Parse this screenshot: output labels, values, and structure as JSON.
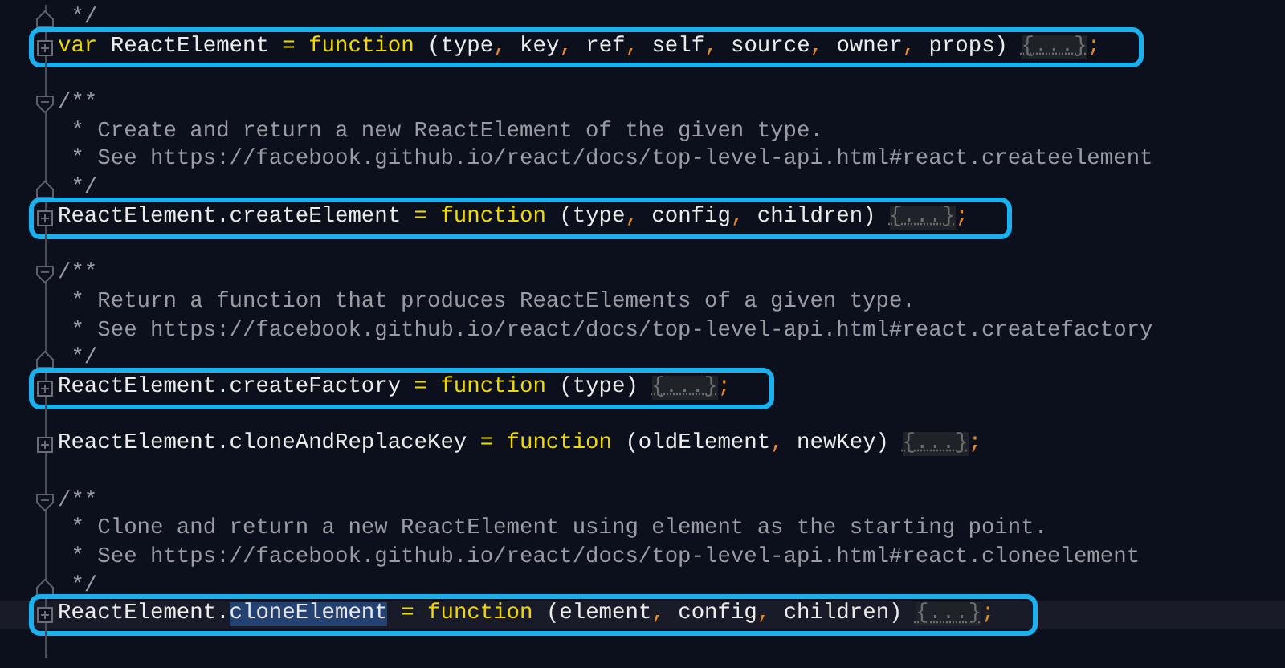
{
  "lines": [
    {
      "kind": "fold_end",
      "boxed": false,
      "current": false,
      "tokens": [
        {
          "kind": "comment",
          "text": " */"
        }
      ]
    },
    {
      "kind": "collapsed",
      "boxed": true,
      "current": false,
      "tokens": [
        {
          "kind": "keyword",
          "text": "var"
        },
        {
          "kind": "plain",
          "text": " ReactElement "
        },
        {
          "kind": "keyword",
          "text": "="
        },
        {
          "kind": "keyword",
          "text": " function"
        },
        {
          "kind": "plain",
          "text": " (type"
        },
        {
          "kind": "punct",
          "text": ","
        },
        {
          "kind": "plain",
          "text": " key"
        },
        {
          "kind": "punct",
          "text": ","
        },
        {
          "kind": "plain",
          "text": " ref"
        },
        {
          "kind": "punct",
          "text": ","
        },
        {
          "kind": "plain",
          "text": " self"
        },
        {
          "kind": "punct",
          "text": ","
        },
        {
          "kind": "plain",
          "text": " source"
        },
        {
          "kind": "punct",
          "text": ","
        },
        {
          "kind": "plain",
          "text": " owner"
        },
        {
          "kind": "punct",
          "text": ","
        },
        {
          "kind": "plain",
          "text": " props) "
        },
        {
          "kind": "folded",
          "text": "{...}"
        },
        {
          "kind": "punct",
          "text": ";"
        }
      ]
    },
    {
      "kind": "blank"
    },
    {
      "kind": "fold_start",
      "boxed": false,
      "current": false,
      "tokens": [
        {
          "kind": "comment",
          "text": "/**"
        }
      ]
    },
    {
      "kind": "code",
      "boxed": false,
      "current": false,
      "tokens": [
        {
          "kind": "comment",
          "text": " * Create and return a new ReactElement of the given type."
        }
      ]
    },
    {
      "kind": "code",
      "boxed": false,
      "current": false,
      "tokens": [
        {
          "kind": "comment",
          "text": " * See https://facebook.github.io/react/docs/top-level-api.html#react.createelement"
        }
      ]
    },
    {
      "kind": "fold_end",
      "boxed": false,
      "current": false,
      "tokens": [
        {
          "kind": "comment",
          "text": " */"
        }
      ]
    },
    {
      "kind": "collapsed",
      "boxed": true,
      "current": false,
      "tokens": [
        {
          "kind": "plain",
          "text": "ReactElement.createElement "
        },
        {
          "kind": "keyword",
          "text": "="
        },
        {
          "kind": "keyword",
          "text": " function"
        },
        {
          "kind": "plain",
          "text": " (type"
        },
        {
          "kind": "punct",
          "text": ","
        },
        {
          "kind": "plain",
          "text": " config"
        },
        {
          "kind": "punct",
          "text": ","
        },
        {
          "kind": "plain",
          "text": " children) "
        },
        {
          "kind": "folded",
          "text": "{...}"
        },
        {
          "kind": "punct",
          "text": ";"
        }
      ]
    },
    {
      "kind": "blank"
    },
    {
      "kind": "fold_start",
      "boxed": false,
      "current": false,
      "tokens": [
        {
          "kind": "comment",
          "text": "/**"
        }
      ]
    },
    {
      "kind": "code",
      "boxed": false,
      "current": false,
      "tokens": [
        {
          "kind": "comment",
          "text": " * Return a function that produces ReactElements of a given type."
        }
      ]
    },
    {
      "kind": "code",
      "boxed": false,
      "current": false,
      "tokens": [
        {
          "kind": "comment",
          "text": " * See https://facebook.github.io/react/docs/top-level-api.html#react.createfactory"
        }
      ]
    },
    {
      "kind": "fold_end",
      "boxed": false,
      "current": false,
      "tokens": [
        {
          "kind": "comment",
          "text": " */"
        }
      ]
    },
    {
      "kind": "collapsed",
      "boxed": true,
      "current": false,
      "tokens": [
        {
          "kind": "plain",
          "text": "ReactElement.createFactory "
        },
        {
          "kind": "keyword",
          "text": "="
        },
        {
          "kind": "keyword",
          "text": " function"
        },
        {
          "kind": "plain",
          "text": " (type) "
        },
        {
          "kind": "folded",
          "text": "{...}"
        },
        {
          "kind": "punct",
          "text": ";"
        }
      ]
    },
    {
      "kind": "blank"
    },
    {
      "kind": "collapsed",
      "boxed": false,
      "current": false,
      "tokens": [
        {
          "kind": "plain",
          "text": "ReactElement.cloneAndReplaceKey "
        },
        {
          "kind": "keyword",
          "text": "="
        },
        {
          "kind": "keyword",
          "text": " function"
        },
        {
          "kind": "plain",
          "text": " (oldElement"
        },
        {
          "kind": "punct",
          "text": ","
        },
        {
          "kind": "plain",
          "text": " newKey) "
        },
        {
          "kind": "folded",
          "text": "{...}"
        },
        {
          "kind": "punct",
          "text": ";"
        }
      ]
    },
    {
      "kind": "blank"
    },
    {
      "kind": "fold_start",
      "boxed": false,
      "current": false,
      "tokens": [
        {
          "kind": "comment",
          "text": "/**"
        }
      ]
    },
    {
      "kind": "code",
      "boxed": false,
      "current": false,
      "tokens": [
        {
          "kind": "comment",
          "text": " * Clone and return a new ReactElement using element as the starting point."
        }
      ]
    },
    {
      "kind": "code",
      "boxed": false,
      "current": false,
      "tokens": [
        {
          "kind": "comment",
          "text": " * See https://facebook.github.io/react/docs/top-level-api.html#react.cloneelement"
        }
      ]
    },
    {
      "kind": "fold_end",
      "boxed": false,
      "current": false,
      "tokens": [
        {
          "kind": "comment",
          "text": " */"
        }
      ]
    },
    {
      "kind": "collapsed",
      "boxed": true,
      "current": true,
      "tokens": [
        {
          "kind": "plain",
          "text": "ReactElement."
        },
        {
          "kind": "selection",
          "text": "cloneElement"
        },
        {
          "kind": "keyword",
          "text": " ="
        },
        {
          "kind": "keyword",
          "text": " function"
        },
        {
          "kind": "plain",
          "text": " (element"
        },
        {
          "kind": "punct",
          "text": ","
        },
        {
          "kind": "plain",
          "text": " config"
        },
        {
          "kind": "punct",
          "text": ","
        },
        {
          "kind": "plain",
          "text": " children) "
        },
        {
          "kind": "folded",
          "text": "{...}"
        },
        {
          "kind": "punct",
          "text": ";"
        }
      ]
    },
    {
      "kind": "blank"
    }
  ]
}
